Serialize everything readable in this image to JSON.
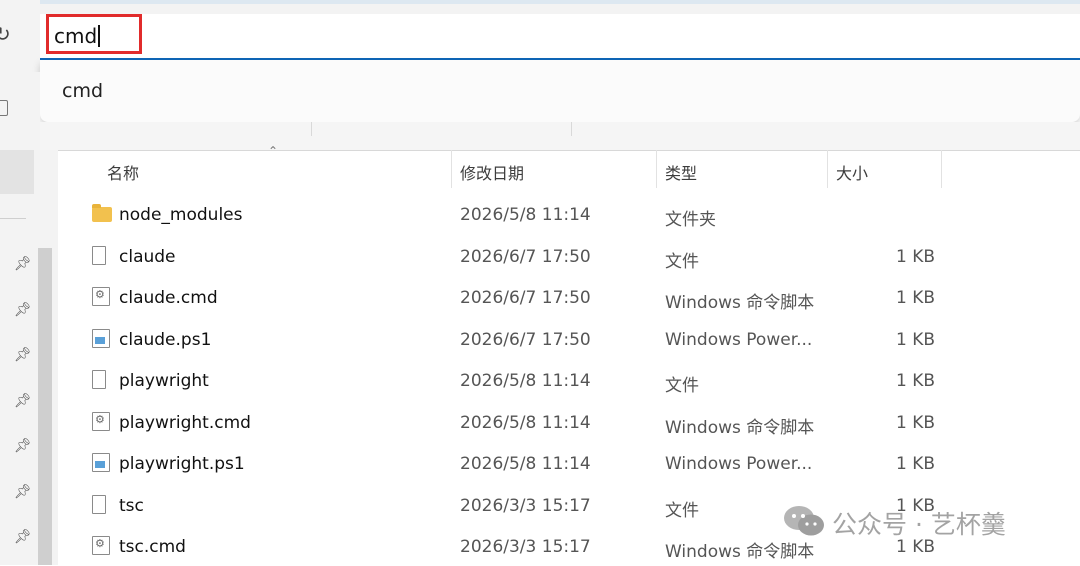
{
  "address_bar": {
    "value": "cmd"
  },
  "suggestions": [
    "cmd"
  ],
  "columns": {
    "name": "名称",
    "date": "修改日期",
    "type": "类型",
    "size": "大小"
  },
  "files": [
    {
      "name": "node_modules",
      "icon": "folder-icon",
      "date": "2026/5/8 11:14",
      "type": "文件夹",
      "size": ""
    },
    {
      "name": "claude",
      "icon": "file-icon",
      "date": "2026/6/7 17:50",
      "type": "文件",
      "size": "1 KB"
    },
    {
      "name": "claude.cmd",
      "icon": "cmd-file-icon",
      "date": "2026/6/7 17:50",
      "type": "Windows 命令脚本",
      "size": "1 KB"
    },
    {
      "name": "claude.ps1",
      "icon": "powershell-file-icon",
      "date": "2026/6/7 17:50",
      "type": "Windows Power...",
      "size": "1 KB"
    },
    {
      "name": "playwright",
      "icon": "file-icon",
      "date": "2026/5/8 11:14",
      "type": "文件",
      "size": "1 KB"
    },
    {
      "name": "playwright.cmd",
      "icon": "cmd-file-icon",
      "date": "2026/5/8 11:14",
      "type": "Windows 命令脚本",
      "size": "1 KB"
    },
    {
      "name": "playwright.ps1",
      "icon": "powershell-file-icon",
      "date": "2026/5/8 11:14",
      "type": "Windows Power...",
      "size": "1 KB"
    },
    {
      "name": "tsc",
      "icon": "file-icon",
      "date": "2026/3/3 15:17",
      "type": "文件",
      "size": "1 KB"
    },
    {
      "name": "tsc.cmd",
      "icon": "cmd-file-icon",
      "date": "2026/3/3 15:17",
      "type": "Windows 命令脚本",
      "size": "1 KB"
    }
  ],
  "watermark": {
    "text": "公众号 · 艺杯羹"
  },
  "colors": {
    "address_underline": "#0f67b8",
    "highlight_box": "#e12b2b",
    "folder": "#f2c14e"
  }
}
